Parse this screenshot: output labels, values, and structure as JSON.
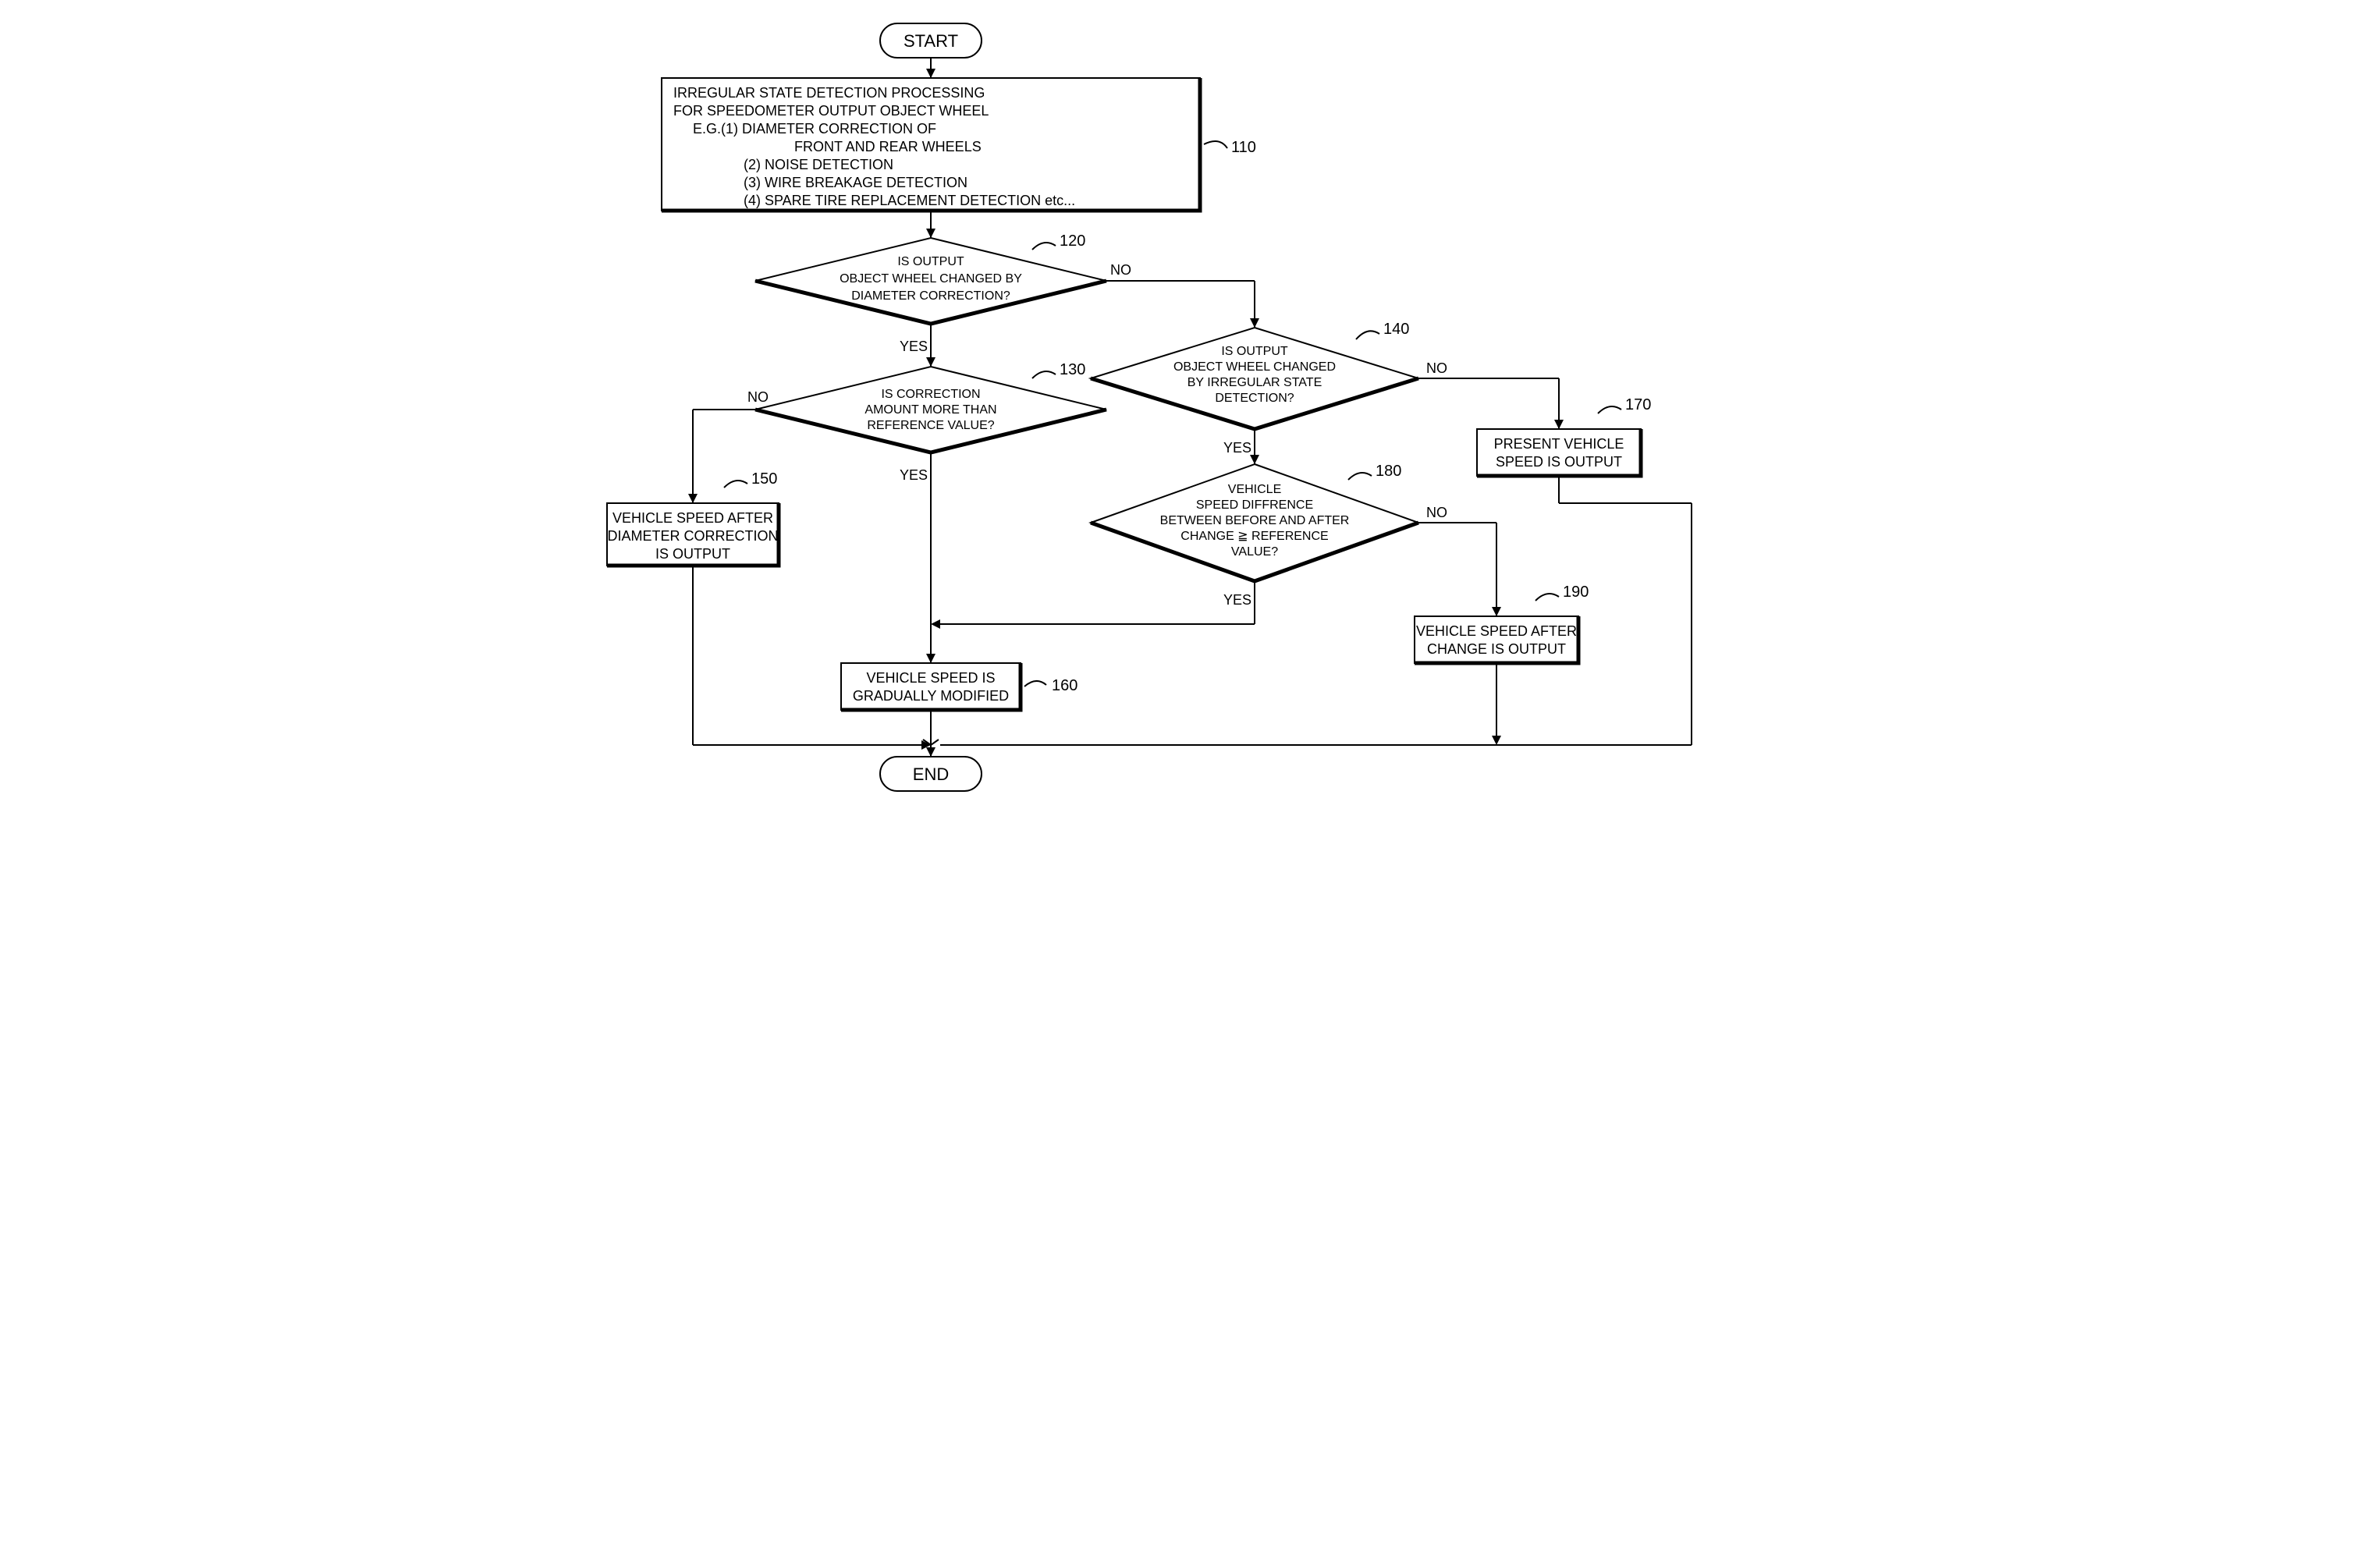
{
  "chart_data": {
    "type": "flowchart",
    "nodes": [
      {
        "id": "start",
        "kind": "terminator",
        "text": "START"
      },
      {
        "id": "110",
        "kind": "process",
        "ref": "110",
        "lines": [
          "IRREGULAR STATE DETECTION PROCESSING",
          "FOR SPEEDOMETER OUTPUT OBJECT WHEEL",
          "E.G.(1) DIAMETER CORRECTION OF",
          "          FRONT AND REAR WHEELS",
          "    (2) NOISE DETECTION",
          "    (3) WIRE BREAKAGE DETECTION",
          "    (4) SPARE TIRE REPLACEMENT DETECTION etc..."
        ]
      },
      {
        "id": "120",
        "kind": "decision",
        "ref": "120",
        "lines": [
          "IS OUTPUT",
          "OBJECT WHEEL CHANGED BY",
          "DIAMETER CORRECTION?"
        ],
        "yes_label": "YES",
        "no_label": "NO"
      },
      {
        "id": "130",
        "kind": "decision",
        "ref": "130",
        "lines": [
          "IS CORRECTION",
          "AMOUNT MORE THAN",
          "REFERENCE VALUE?"
        ],
        "yes_label": "YES",
        "no_label": "NO"
      },
      {
        "id": "140",
        "kind": "decision",
        "ref": "140",
        "lines": [
          "IS OUTPUT",
          "OBJECT WHEEL CHANGED",
          "BY IRREGULAR STATE",
          "DETECTION?"
        ],
        "yes_label": "YES",
        "no_label": "NO"
      },
      {
        "id": "180",
        "kind": "decision",
        "ref": "180",
        "lines": [
          "VEHICLE",
          "SPEED DIFFRENCE",
          "BETWEEN BEFORE AND AFTER",
          "CHANGE ≧ REFERENCE",
          "VALUE?"
        ],
        "yes_label": "YES",
        "no_label": "NO"
      },
      {
        "id": "150",
        "kind": "process",
        "ref": "150",
        "lines": [
          "VEHICLE SPEED AFTER",
          "DIAMETER CORRECTION",
          "IS OUTPUT"
        ]
      },
      {
        "id": "160",
        "kind": "process",
        "ref": "160",
        "lines": [
          "VEHICLE SPEED IS",
          "GRADUALLY MODIFIED"
        ]
      },
      {
        "id": "170",
        "kind": "process",
        "ref": "170",
        "lines": [
          "PRESENT VEHICLE",
          "SPEED IS OUTPUT"
        ]
      },
      {
        "id": "190",
        "kind": "process",
        "ref": "190",
        "lines": [
          "VEHICLE SPEED AFTER",
          "CHANGE IS OUTPUT"
        ]
      },
      {
        "id": "end",
        "kind": "terminator",
        "text": "END"
      }
    ],
    "edges": [
      {
        "from": "start",
        "to": "110"
      },
      {
        "from": "110",
        "to": "120"
      },
      {
        "from": "120",
        "to": "130",
        "label": "YES"
      },
      {
        "from": "120",
        "to": "140",
        "label": "NO"
      },
      {
        "from": "130",
        "to": "160",
        "label": "YES"
      },
      {
        "from": "130",
        "to": "150",
        "label": "NO"
      },
      {
        "from": "140",
        "to": "180",
        "label": "YES"
      },
      {
        "from": "140",
        "to": "170",
        "label": "NO"
      },
      {
        "from": "180",
        "to": "160",
        "label": "YES"
      },
      {
        "from": "180",
        "to": "190",
        "label": "NO"
      },
      {
        "from": "150",
        "to": "end"
      },
      {
        "from": "160",
        "to": "end"
      },
      {
        "from": "170",
        "to": "end"
      },
      {
        "from": "190",
        "to": "end"
      }
    ]
  }
}
